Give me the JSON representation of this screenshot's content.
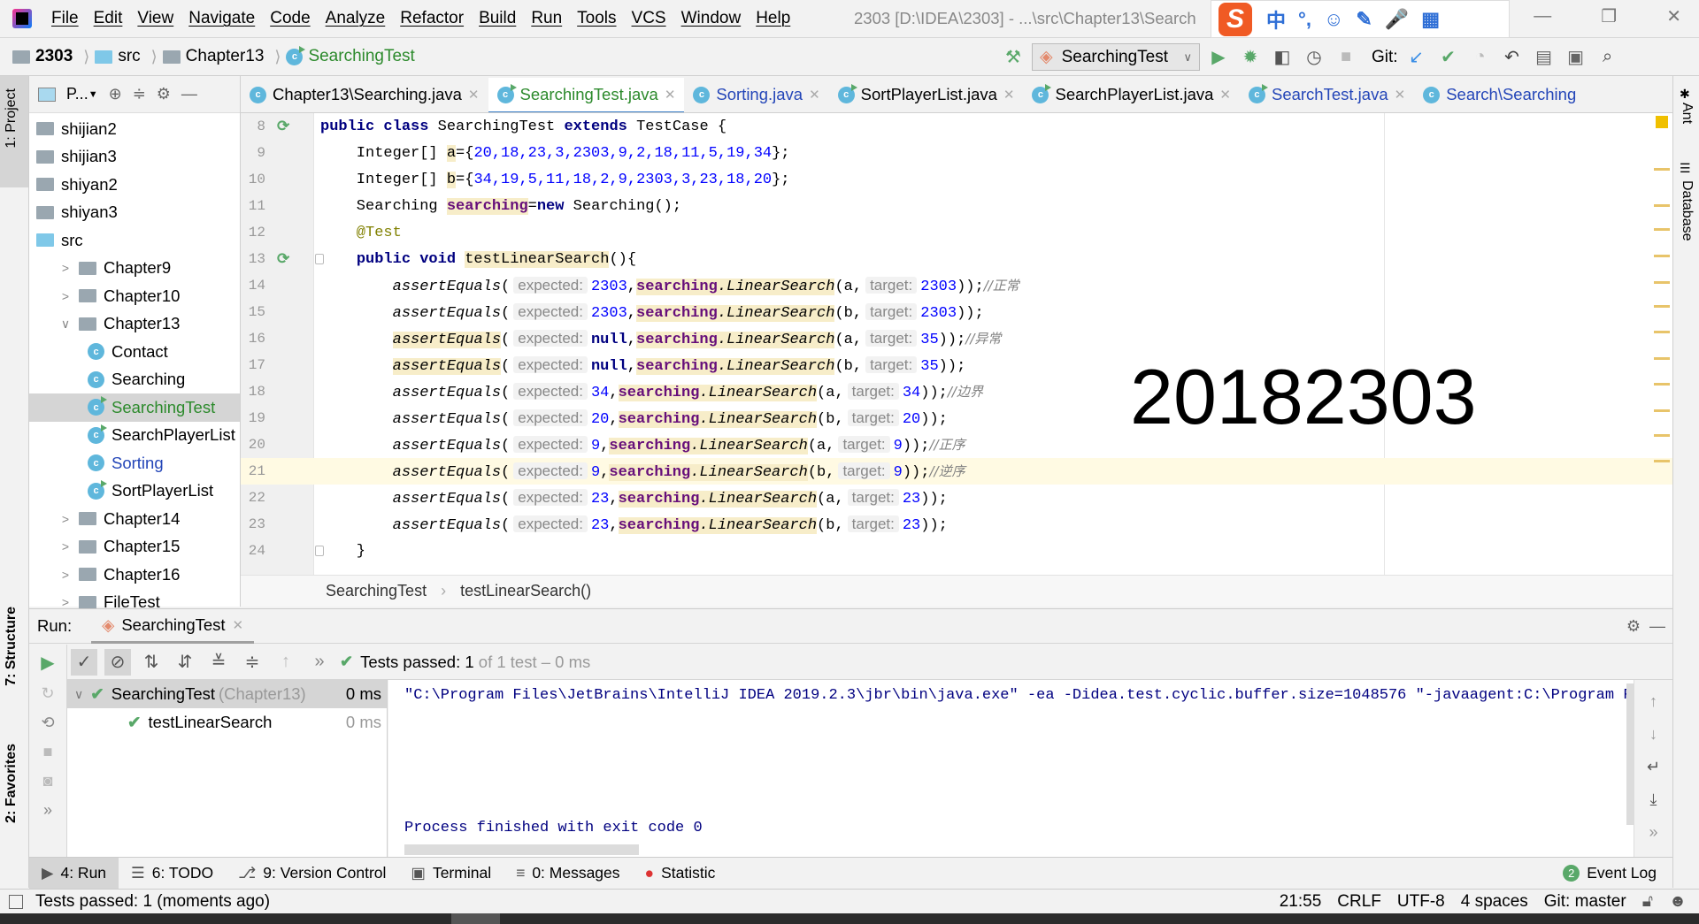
{
  "window": {
    "title": "2303 [D:\\IDEA\\2303] - ...\\src\\Chapter13\\Search",
    "menu": [
      "File",
      "Edit",
      "View",
      "Navigate",
      "Code",
      "Analyze",
      "Refactor",
      "Build",
      "Run",
      "Tools",
      "VCS",
      "Window",
      "Help"
    ],
    "ime_toolbar": {
      "logo": "S",
      "items": [
        "中",
        "°,",
        "☺",
        "✎",
        "🎤",
        "▦"
      ]
    }
  },
  "navbar": {
    "breadcrumb": [
      {
        "label": "2303",
        "icon": "project-folder-icon"
      },
      {
        "label": "src",
        "icon": "source-folder-icon"
      },
      {
        "label": "Chapter13",
        "icon": "package-icon"
      },
      {
        "label": "SearchingTest",
        "icon": "test-class-icon"
      }
    ],
    "run_config": "SearchingTest",
    "git_label": "Git:"
  },
  "project_panel": {
    "title": "P...",
    "items": [
      {
        "label": "shijian2",
        "type": "folder",
        "depth": 0
      },
      {
        "label": "shijian3",
        "type": "folder",
        "depth": 0
      },
      {
        "label": "shiyan2",
        "type": "folder",
        "depth": 0
      },
      {
        "label": "shiyan3",
        "type": "folder",
        "depth": 0
      },
      {
        "label": "src",
        "type": "src",
        "depth": 0
      },
      {
        "label": "Chapter9",
        "type": "package",
        "depth": 1,
        "arrow": "›"
      },
      {
        "label": "Chapter10",
        "type": "package",
        "depth": 1,
        "arrow": "›"
      },
      {
        "label": "Chapter13",
        "type": "package",
        "depth": 1,
        "arrow": "⌄"
      },
      {
        "label": "Contact",
        "type": "class",
        "depth": 2
      },
      {
        "label": "Searching",
        "type": "class",
        "depth": 2
      },
      {
        "label": "SearchingTest",
        "type": "test",
        "depth": 2,
        "selected": true,
        "color": "#2c8a2c"
      },
      {
        "label": "SearchPlayerList",
        "type": "test",
        "depth": 2
      },
      {
        "label": "Sorting",
        "type": "class",
        "depth": 2,
        "color": "#2446b8"
      },
      {
        "label": "SortPlayerList",
        "type": "test",
        "depth": 2
      },
      {
        "label": "Chapter14",
        "type": "package",
        "depth": 1,
        "arrow": "›"
      },
      {
        "label": "Chapter15",
        "type": "package",
        "depth": 1,
        "arrow": "›"
      },
      {
        "label": "Chapter16",
        "type": "package",
        "depth": 1,
        "arrow": "›"
      },
      {
        "label": "FileTest",
        "type": "package",
        "depth": 1,
        "arrow": "›"
      }
    ]
  },
  "tabs": [
    {
      "label": "Chapter13\\Searching.java",
      "icon": "class",
      "color": "#000"
    },
    {
      "label": "SearchingTest.java",
      "icon": "test",
      "color": "#2c8a2c",
      "active": true
    },
    {
      "label": "Sorting.java",
      "icon": "class",
      "color": "#2446b8"
    },
    {
      "label": "SortPlayerList.java",
      "icon": "test",
      "color": "#000"
    },
    {
      "label": "SearchPlayerList.java",
      "icon": "test",
      "color": "#000"
    },
    {
      "label": "SearchTest.java",
      "icon": "test",
      "color": "#2446b8"
    },
    {
      "label": "Search\\Searching",
      "icon": "class",
      "color": "#2446b8",
      "noclose": true
    }
  ],
  "editor": {
    "current_line": 21,
    "lines": [
      {
        "n": 8,
        "run": true,
        "tokens": [
          [
            "k",
            "public class "
          ],
          [
            "p",
            "SearchingTest "
          ],
          [
            "k",
            "extends "
          ],
          [
            "p",
            "TestCase {"
          ]
        ]
      },
      {
        "n": 9,
        "tokens": [
          [
            "p",
            "    Integer[] "
          ],
          [
            "p",
            "a",
            1
          ],
          [
            "p",
            "={"
          ],
          [
            "n",
            "20,18,23,3,2303,9,2,18,11,5,19,34"
          ],
          [
            "p",
            "};"
          ]
        ]
      },
      {
        "n": 10,
        "tokens": [
          [
            "p",
            "    Integer[] "
          ],
          [
            "p",
            "b",
            1
          ],
          [
            "p",
            "={"
          ],
          [
            "n",
            "34,19,5,11,18,2,9,2303,3,23,18,20"
          ],
          [
            "p",
            "};"
          ]
        ]
      },
      {
        "n": 11,
        "tokens": [
          [
            "p",
            "    Searching "
          ],
          [
            "f",
            "searching",
            1
          ],
          [
            "p",
            "="
          ],
          [
            "k",
            "new"
          ],
          [
            "p",
            " Searching();"
          ]
        ]
      },
      {
        "n": 12,
        "tokens": [
          [
            "a",
            "    @Test"
          ]
        ]
      },
      {
        "n": 13,
        "run": true,
        "fold": true,
        "tokens": [
          [
            "p",
            "    "
          ],
          [
            "k",
            "public void "
          ],
          [
            "p",
            "testLinearSearch",
            1
          ],
          [
            "p",
            "(){"
          ]
        ]
      },
      {
        "n": 14,
        "tokens": [
          [
            "p",
            "        "
          ],
          [
            "i",
            "assertEquals"
          ],
          [
            "p",
            "("
          ],
          [
            "h",
            "expected:"
          ],
          [
            "n",
            "2303"
          ],
          [
            "p",
            ","
          ],
          [
            "f",
            "searching",
            1
          ],
          [
            "i",
            ".LinearSearch",
            1
          ],
          [
            "p",
            "(a,"
          ],
          [
            "h",
            "target:"
          ],
          [
            "n",
            "2303"
          ],
          [
            "p",
            "));"
          ],
          [
            "c",
            "//正常"
          ]
        ]
      },
      {
        "n": 15,
        "tokens": [
          [
            "p",
            "        "
          ],
          [
            "i",
            "assertEquals"
          ],
          [
            "p",
            "("
          ],
          [
            "h",
            "expected:"
          ],
          [
            "n",
            "2303"
          ],
          [
            "p",
            ","
          ],
          [
            "f",
            "searching",
            1
          ],
          [
            "i",
            ".LinearSearch",
            1
          ],
          [
            "p",
            "(b,"
          ],
          [
            "h",
            "target:"
          ],
          [
            "n",
            "2303"
          ],
          [
            "p",
            "));"
          ]
        ]
      },
      {
        "n": 16,
        "tokens": [
          [
            "p",
            "        "
          ],
          [
            "i",
            "assertEquals",
            1
          ],
          [
            "p",
            "("
          ],
          [
            "h",
            "expected:"
          ],
          [
            "k",
            "null"
          ],
          [
            "p",
            ","
          ],
          [
            "f",
            "searching",
            1
          ],
          [
            "i",
            ".LinearSearch",
            1
          ],
          [
            "p",
            "(a,"
          ],
          [
            "h",
            "target:"
          ],
          [
            "n",
            "35"
          ],
          [
            "p",
            "));"
          ],
          [
            "c",
            "//异常"
          ]
        ]
      },
      {
        "n": 17,
        "tokens": [
          [
            "p",
            "        "
          ],
          [
            "i",
            "assertEquals",
            1
          ],
          [
            "p",
            "("
          ],
          [
            "h",
            "expected:"
          ],
          [
            "k",
            "null"
          ],
          [
            "p",
            ","
          ],
          [
            "f",
            "searching",
            1
          ],
          [
            "i",
            ".LinearSearch",
            1
          ],
          [
            "p",
            "(b,"
          ],
          [
            "h",
            "target:"
          ],
          [
            "n",
            "35"
          ],
          [
            "p",
            "));"
          ]
        ]
      },
      {
        "n": 18,
        "tokens": [
          [
            "p",
            "        "
          ],
          [
            "i",
            "assertEquals"
          ],
          [
            "p",
            "("
          ],
          [
            "h",
            "expected:"
          ],
          [
            "n",
            "34"
          ],
          [
            "p",
            ","
          ],
          [
            "f",
            "searching",
            1
          ],
          [
            "i",
            ".LinearSearch",
            1
          ],
          [
            "p",
            "(a,"
          ],
          [
            "h",
            "target:"
          ],
          [
            "n",
            "34"
          ],
          [
            "p",
            "));"
          ],
          [
            "c",
            "//边界"
          ]
        ]
      },
      {
        "n": 19,
        "tokens": [
          [
            "p",
            "        "
          ],
          [
            "i",
            "assertEquals"
          ],
          [
            "p",
            "("
          ],
          [
            "h",
            "expected:"
          ],
          [
            "n",
            "20"
          ],
          [
            "p",
            ","
          ],
          [
            "f",
            "searching",
            1
          ],
          [
            "i",
            ".LinearSearch",
            1
          ],
          [
            "p",
            "(b,"
          ],
          [
            "h",
            "target:"
          ],
          [
            "n",
            "20"
          ],
          [
            "p",
            "));"
          ]
        ]
      },
      {
        "n": 20,
        "tokens": [
          [
            "p",
            "        "
          ],
          [
            "i",
            "assertEquals"
          ],
          [
            "p",
            "("
          ],
          [
            "h",
            "expected:"
          ],
          [
            "n",
            "9"
          ],
          [
            "p",
            ","
          ],
          [
            "f",
            "searching",
            1
          ],
          [
            "i",
            ".LinearSearch",
            1
          ],
          [
            "p",
            "(a,"
          ],
          [
            "h",
            "target:"
          ],
          [
            "n",
            "9"
          ],
          [
            "p",
            "));"
          ],
          [
            "c",
            "//正序"
          ]
        ]
      },
      {
        "n": 21,
        "tokens": [
          [
            "p",
            "        "
          ],
          [
            "i",
            "assertEquals"
          ],
          [
            "p",
            "("
          ],
          [
            "h",
            "expected:"
          ],
          [
            "n",
            "9"
          ],
          [
            "p",
            ","
          ],
          [
            "f",
            "searching",
            1
          ],
          [
            "i",
            ".LinearSearch",
            1
          ],
          [
            "p",
            "(b,"
          ],
          [
            "h",
            "target:"
          ],
          [
            "n",
            "9"
          ],
          [
            "p",
            "));"
          ],
          [
            "c",
            "//逆序"
          ]
        ]
      },
      {
        "n": 22,
        "tokens": [
          [
            "p",
            "        "
          ],
          [
            "i",
            "assertEquals"
          ],
          [
            "p",
            "("
          ],
          [
            "h",
            "expected:"
          ],
          [
            "n",
            "23"
          ],
          [
            "p",
            ","
          ],
          [
            "f",
            "searching",
            1
          ],
          [
            "i",
            ".LinearSearch",
            1
          ],
          [
            "p",
            "(a,"
          ],
          [
            "h",
            "target:"
          ],
          [
            "n",
            "23"
          ],
          [
            "p",
            "));"
          ]
        ]
      },
      {
        "n": 23,
        "tokens": [
          [
            "p",
            "        "
          ],
          [
            "i",
            "assertEquals"
          ],
          [
            "p",
            "("
          ],
          [
            "h",
            "expected:"
          ],
          [
            "n",
            "23"
          ],
          [
            "p",
            ","
          ],
          [
            "f",
            "searching",
            1
          ],
          [
            "i",
            ".LinearSearch",
            1
          ],
          [
            "p",
            "(b,"
          ],
          [
            "h",
            "target:"
          ],
          [
            "n",
            "23"
          ],
          [
            "p",
            "));"
          ]
        ]
      },
      {
        "n": 24,
        "fold": true,
        "tokens": [
          [
            "p",
            "    }"
          ]
        ]
      }
    ],
    "overlay_text": "20182303",
    "breadcrumb": [
      "SearchingTest",
      "testLinearSearch()"
    ]
  },
  "run_panel": {
    "label": "Run:",
    "tab": "SearchingTest",
    "status_prefix": "Tests passed:",
    "status_count": "1",
    "status_suffix": "of 1 test – 0 ms",
    "tree": [
      {
        "label": "SearchingTest",
        "sub": "(Chapter13)",
        "time": "0 ms",
        "selected": true
      },
      {
        "label": "testLinearSearch",
        "time": "0 ms"
      }
    ],
    "console": [
      "\"C:\\Program Files\\JetBrains\\IntelliJ IDEA 2019.2.3\\jbr\\bin\\java.exe\" -ea -Didea.test.cyclic.buffer.size=1048576 \"-javaagent:C:\\Program File",
      "Process finished with exit code 0"
    ]
  },
  "side_tabs": {
    "left": [
      "1: Project",
      "7: Structure",
      "2: Favorites"
    ],
    "right": [
      "Ant",
      "Database"
    ]
  },
  "bottom_tabs": [
    {
      "label": "4: Run",
      "icon": "▶",
      "active": true
    },
    {
      "label": "6: TODO",
      "icon": "☰"
    },
    {
      "label": "9: Version Control",
      "icon": "⎇"
    },
    {
      "label": "Terminal",
      "icon": "▣"
    },
    {
      "label": "0: Messages",
      "icon": "≡"
    },
    {
      "label": "Statistic",
      "icon": "●"
    }
  ],
  "event_log": {
    "label": "Event Log",
    "badge": "2"
  },
  "status_bar": {
    "message": "Tests passed: 1 (moments ago)",
    "position": "21:55",
    "line_sep": "CRLF",
    "encoding": "UTF-8",
    "indent": "4 spaces",
    "git": "Git: master"
  },
  "colors": {
    "accent": "#4083c9",
    "test_green": "#59a869",
    "keyword": "#000080",
    "number": "#0000ff",
    "field": "#660e7a",
    "highlight": "#f7edc9",
    "current_line": "#fffae3"
  }
}
